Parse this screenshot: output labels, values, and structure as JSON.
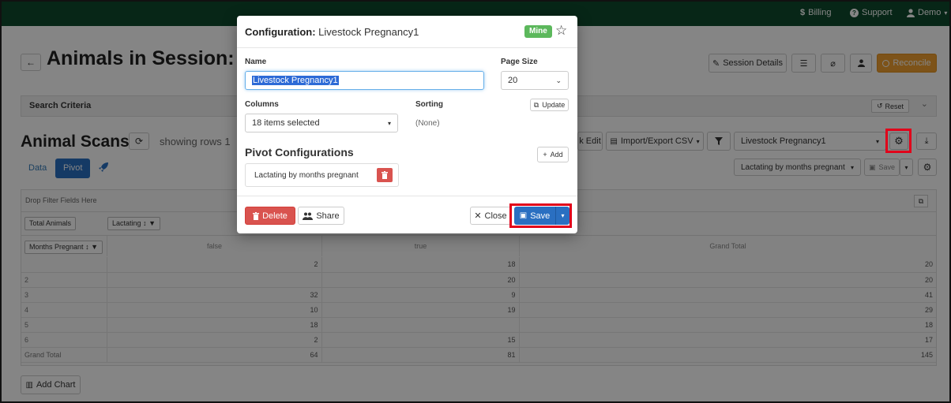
{
  "nav": {
    "billing": "Billing",
    "support": "Support",
    "user": "Demo"
  },
  "page": {
    "title": "Animals in Session: h",
    "session_details": "Session Details",
    "reconcile": "Reconcile",
    "search_criteria": "Search Criteria",
    "reset": "Reset",
    "scans_title": "Animal Scans",
    "showing": "showing rows 1",
    "bulk_edit": "k Edit",
    "import_export": "Import/Export CSV",
    "config_select": "Livestock Pregnancy1",
    "tabs": {
      "data": "Data",
      "pivot": "Pivot"
    },
    "pivot_config_select": "Lactating by months pregnant",
    "save_small": "Save",
    "add_chart": "Add Chart"
  },
  "pivot_table": {
    "drop_filter": "Drop Filter Fields Here",
    "total_animals": "Total Animals",
    "lactating": "Lactating",
    "months_pregnant": "Months Pregnant",
    "col_headers": [
      "false",
      "true",
      "Grand Total"
    ],
    "rows": [
      {
        "label": "",
        "false": "2",
        "true": "18",
        "total": "20"
      },
      {
        "label": "2",
        "false": "",
        "true": "20",
        "total": "20"
      },
      {
        "label": "3",
        "false": "32",
        "true": "9",
        "total": "41"
      },
      {
        "label": "4",
        "false": "10",
        "true": "19",
        "total": "29"
      },
      {
        "label": "5",
        "false": "18",
        "true": "",
        "total": "18"
      },
      {
        "label": "6",
        "false": "2",
        "true": "15",
        "total": "17"
      },
      {
        "label": "Grand Total",
        "false": "64",
        "true": "81",
        "total": "145"
      }
    ]
  },
  "modal": {
    "title_prefix": "Configuration:",
    "title_name": "Livestock Pregnancy1",
    "badge": "Mine",
    "name_label": "Name",
    "name_value": "Livestock Pregnancy1",
    "page_size_label": "Page Size",
    "page_size_value": "20",
    "columns_label": "Columns",
    "columns_value": "18 items selected",
    "sorting_label": "Sorting",
    "sorting_value": "(None)",
    "update": "Update",
    "pivot_heading": "Pivot Configurations",
    "add": "Add",
    "pivot_item": "Lactating by months pregnant",
    "delete": "Delete",
    "share": "Share",
    "close": "Close",
    "save": "Save"
  },
  "colors": {
    "nav_bg": "#0f4a2c",
    "primary": "#2a6fc1",
    "danger": "#d9534f",
    "success": "#5cb85c",
    "warning": "#f0a030",
    "highlight": "#e1001a"
  }
}
